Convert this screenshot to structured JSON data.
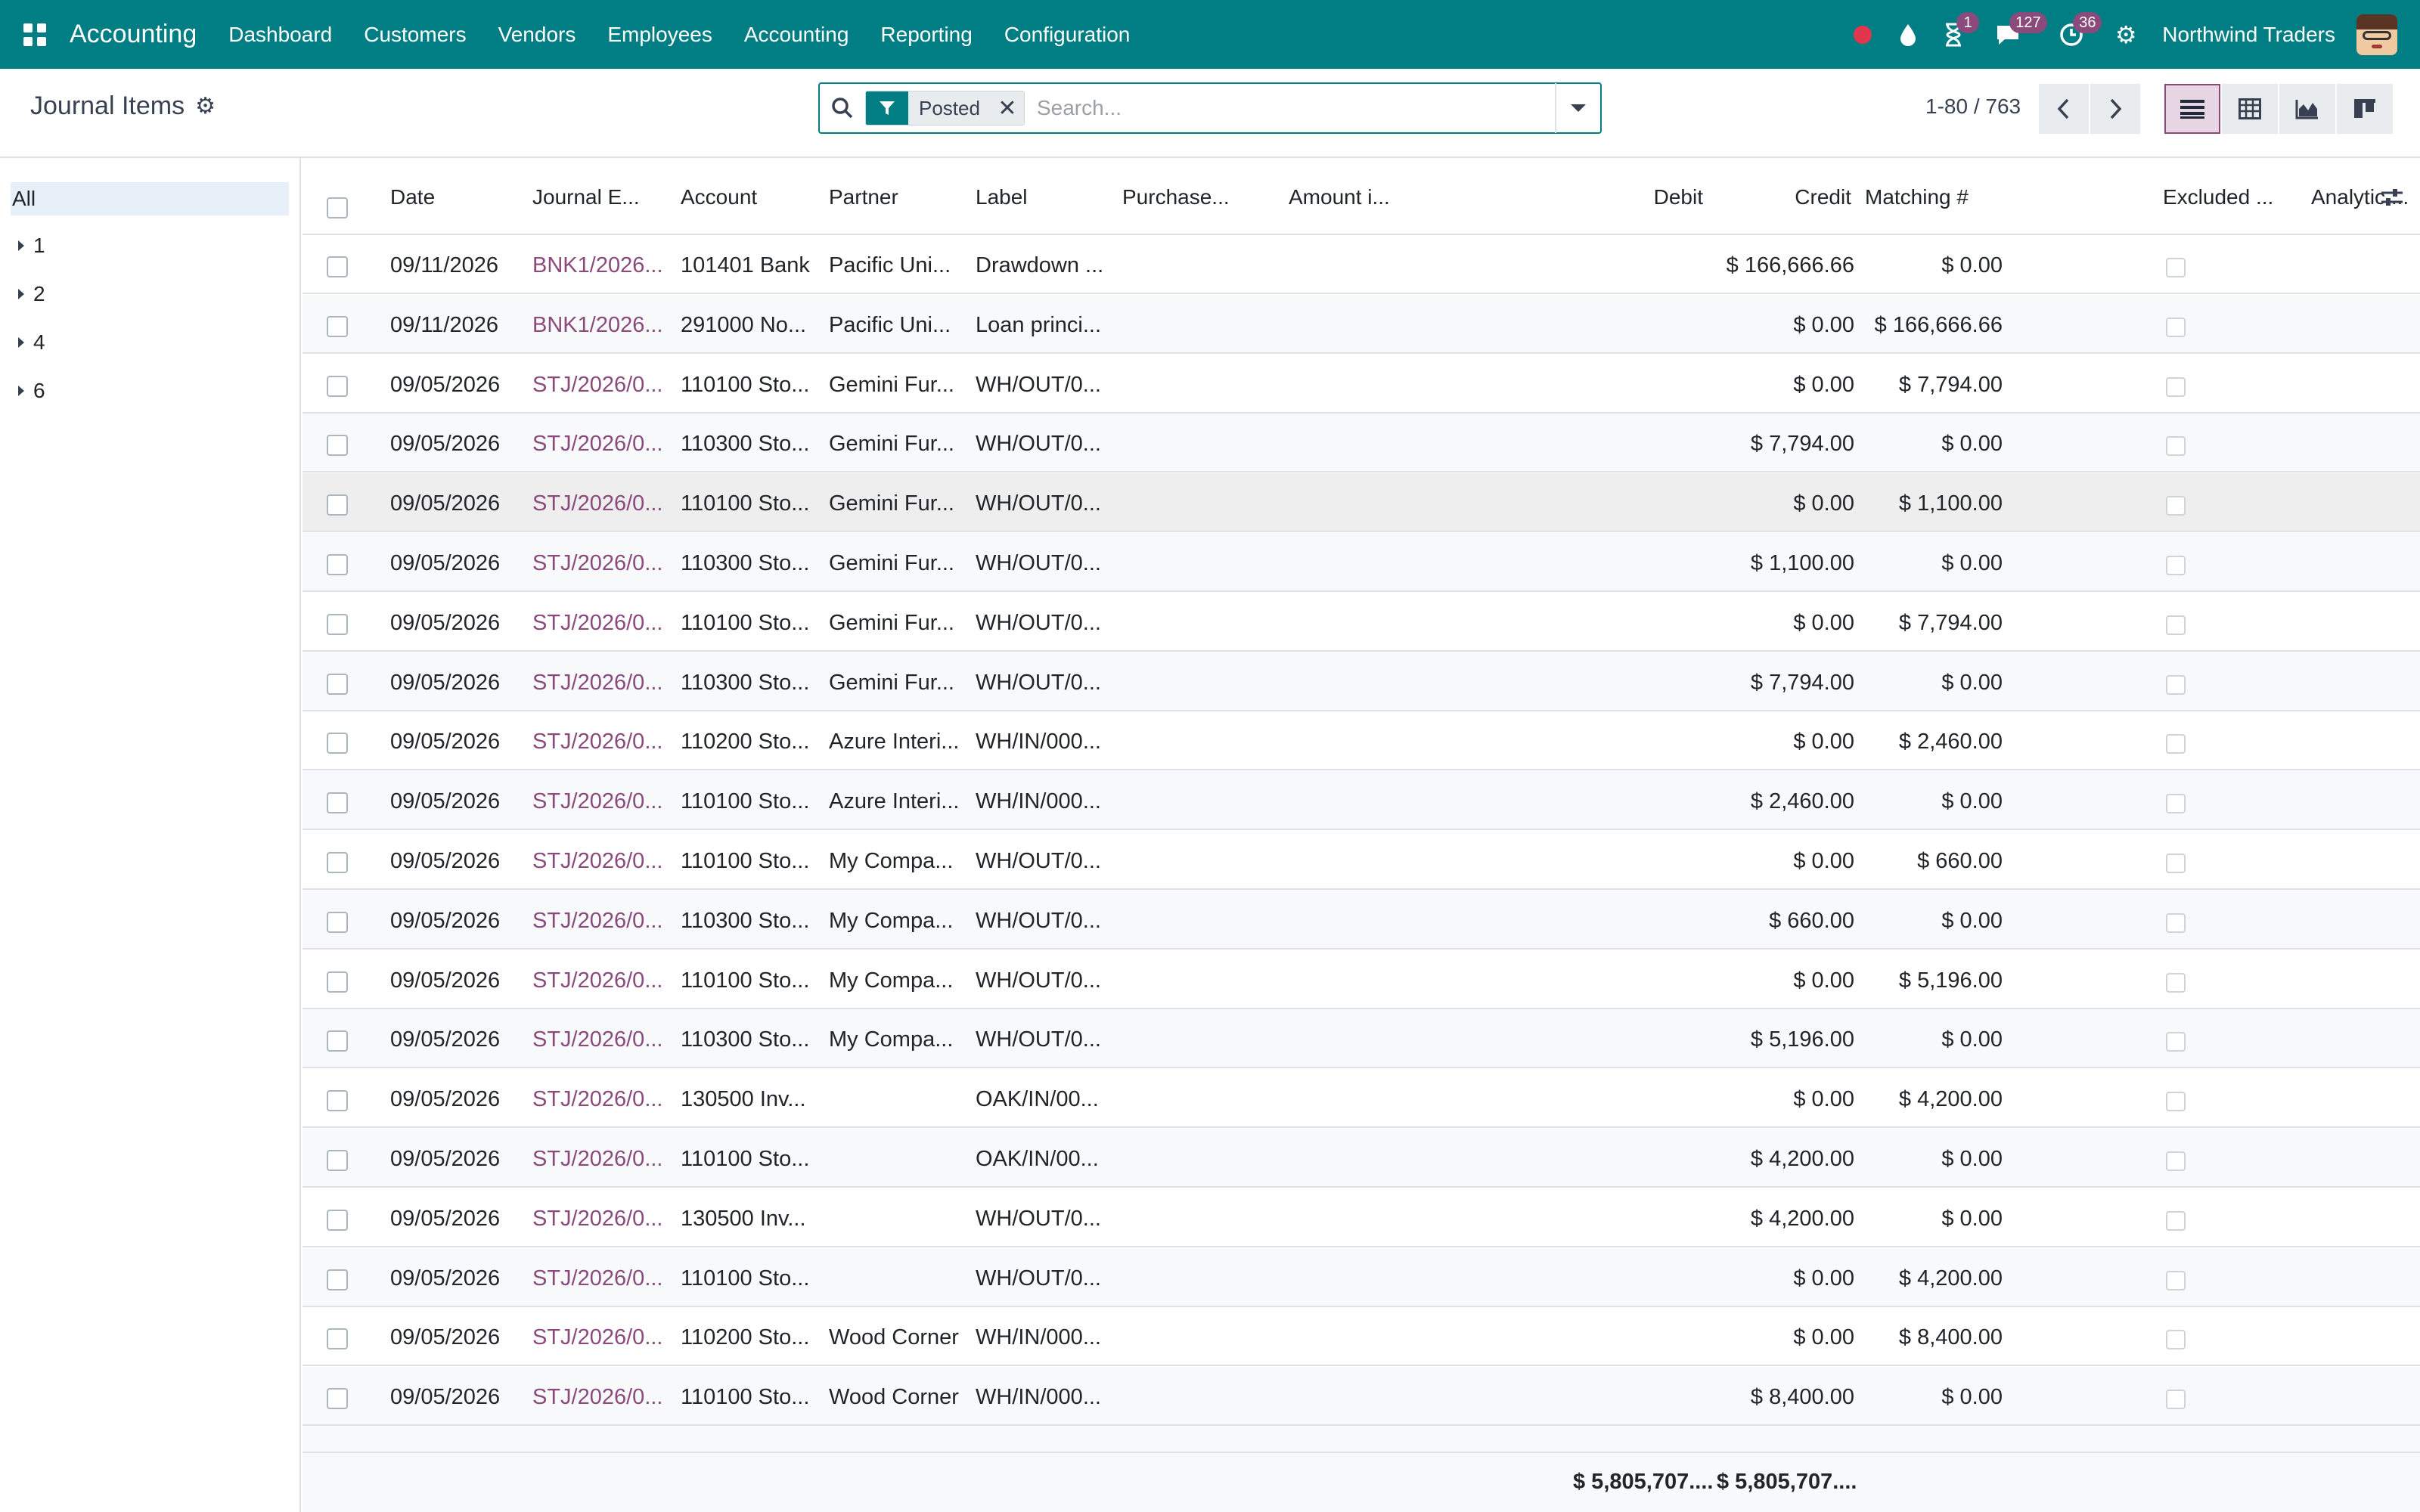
{
  "navbar": {
    "app_name": "Accounting",
    "menu": [
      "Dashboard",
      "Customers",
      "Vendors",
      "Employees",
      "Accounting",
      "Reporting",
      "Configuration"
    ],
    "badges": {
      "activities": "1",
      "messages": "127",
      "timesheets": "36"
    },
    "company": "Northwind Traders",
    "colors": {
      "primary": "#017e84",
      "badge": "#8a4a7c",
      "record": "#e0364e"
    }
  },
  "control": {
    "title": "Journal Items",
    "facet_label": "Posted",
    "search_placeholder": "Search...",
    "pager": "1-80 / 763"
  },
  "sidebar": {
    "all_label": "All",
    "groups": [
      "1",
      "2",
      "4",
      "6"
    ]
  },
  "table": {
    "columns": [
      "Date",
      "Journal E...",
      "Account",
      "Partner",
      "Label",
      "Purchase...",
      "Amount i...",
      "Debit",
      "Credit",
      "Matching #",
      "Excluded ...",
      "Analytic ..."
    ],
    "rows": [
      {
        "date": "09/11/2026",
        "entry": "BNK1/2026...",
        "account": "101401 Bank",
        "partner": "Pacific Uni...",
        "label": "Drawdown ...",
        "debit": "$ 166,666.66",
        "credit": "$ 0.00"
      },
      {
        "date": "09/11/2026",
        "entry": "BNK1/2026...",
        "account": "291000 No...",
        "partner": "Pacific Uni...",
        "label": "Loan princi...",
        "debit": "$ 0.00",
        "credit": "$ 166,666.66"
      },
      {
        "date": "09/05/2026",
        "entry": "STJ/2026/0...",
        "account": "110100 Sto...",
        "partner": "Gemini Fur...",
        "label": "WH/OUT/0...",
        "debit": "$ 0.00",
        "credit": "$ 7,794.00"
      },
      {
        "date": "09/05/2026",
        "entry": "STJ/2026/0...",
        "account": "110300 Sto...",
        "partner": "Gemini Fur...",
        "label": "WH/OUT/0...",
        "debit": "$ 7,794.00",
        "credit": "$ 0.00"
      },
      {
        "date": "09/05/2026",
        "entry": "STJ/2026/0...",
        "account": "110100 Sto...",
        "partner": "Gemini Fur...",
        "label": "WH/OUT/0...",
        "debit": "$ 0.00",
        "credit": "$ 1,100.00"
      },
      {
        "date": "09/05/2026",
        "entry": "STJ/2026/0...",
        "account": "110300 Sto...",
        "partner": "Gemini Fur...",
        "label": "WH/OUT/0...",
        "debit": "$ 1,100.00",
        "credit": "$ 0.00"
      },
      {
        "date": "09/05/2026",
        "entry": "STJ/2026/0...",
        "account": "110100 Sto...",
        "partner": "Gemini Fur...",
        "label": "WH/OUT/0...",
        "debit": "$ 0.00",
        "credit": "$ 7,794.00"
      },
      {
        "date": "09/05/2026",
        "entry": "STJ/2026/0...",
        "account": "110300 Sto...",
        "partner": "Gemini Fur...",
        "label": "WH/OUT/0...",
        "debit": "$ 7,794.00",
        "credit": "$ 0.00"
      },
      {
        "date": "09/05/2026",
        "entry": "STJ/2026/0...",
        "account": "110200 Sto...",
        "partner": "Azure Interi...",
        "label": "WH/IN/000...",
        "debit": "$ 0.00",
        "credit": "$ 2,460.00"
      },
      {
        "date": "09/05/2026",
        "entry": "STJ/2026/0...",
        "account": "110100 Sto...",
        "partner": "Azure Interi...",
        "label": "WH/IN/000...",
        "debit": "$ 2,460.00",
        "credit": "$ 0.00"
      },
      {
        "date": "09/05/2026",
        "entry": "STJ/2026/0...",
        "account": "110100 Sto...",
        "partner": "My Compa...",
        "label": "WH/OUT/0...",
        "debit": "$ 0.00",
        "credit": "$ 660.00"
      },
      {
        "date": "09/05/2026",
        "entry": "STJ/2026/0...",
        "account": "110300 Sto...",
        "partner": "My Compa...",
        "label": "WH/OUT/0...",
        "debit": "$ 660.00",
        "credit": "$ 0.00"
      },
      {
        "date": "09/05/2026",
        "entry": "STJ/2026/0...",
        "account": "110100 Sto...",
        "partner": "My Compa...",
        "label": "WH/OUT/0...",
        "debit": "$ 0.00",
        "credit": "$ 5,196.00"
      },
      {
        "date": "09/05/2026",
        "entry": "STJ/2026/0...",
        "account": "110300 Sto...",
        "partner": "My Compa...",
        "label": "WH/OUT/0...",
        "debit": "$ 5,196.00",
        "credit": "$ 0.00"
      },
      {
        "date": "09/05/2026",
        "entry": "STJ/2026/0...",
        "account": "130500 Inv...",
        "partner": "",
        "label": "OAK/IN/00...",
        "debit": "$ 0.00",
        "credit": "$ 4,200.00"
      },
      {
        "date": "09/05/2026",
        "entry": "STJ/2026/0...",
        "account": "110100 Sto...",
        "partner": "",
        "label": "OAK/IN/00...",
        "debit": "$ 4,200.00",
        "credit": "$ 0.00"
      },
      {
        "date": "09/05/2026",
        "entry": "STJ/2026/0...",
        "account": "130500 Inv...",
        "partner": "",
        "label": "WH/OUT/0...",
        "debit": "$ 4,200.00",
        "credit": "$ 0.00"
      },
      {
        "date": "09/05/2026",
        "entry": "STJ/2026/0...",
        "account": "110100 Sto...",
        "partner": "",
        "label": "WH/OUT/0...",
        "debit": "$ 0.00",
        "credit": "$ 4,200.00"
      },
      {
        "date": "09/05/2026",
        "entry": "STJ/2026/0...",
        "account": "110200 Sto...",
        "partner": "Wood Corner",
        "label": "WH/IN/000...",
        "debit": "$ 0.00",
        "credit": "$ 8,400.00"
      },
      {
        "date": "09/05/2026",
        "entry": "STJ/2026/0...",
        "account": "110100 Sto...",
        "partner": "Wood Corner",
        "label": "WH/IN/000...",
        "debit": "$ 8,400.00",
        "credit": "$ 0.00"
      }
    ],
    "totals": {
      "debit": "$ 5,805,707....",
      "credit": "$ 5,805,707...."
    }
  }
}
